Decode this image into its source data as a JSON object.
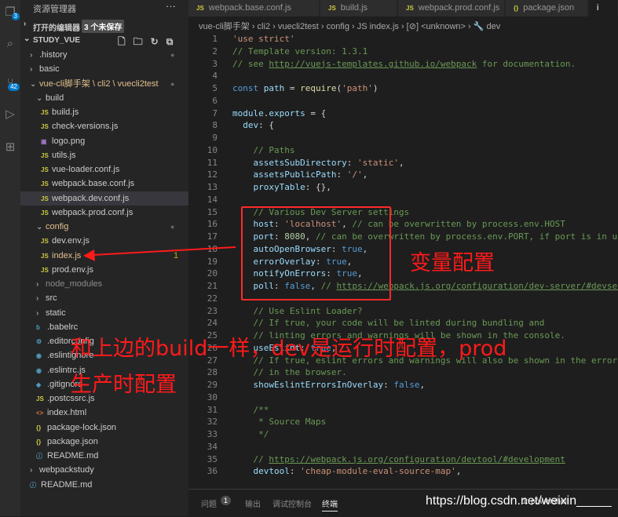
{
  "activity": {
    "explorer_badge": "3",
    "scm_badge": "42"
  },
  "sidebar": {
    "title": "资源管理器",
    "more": "···",
    "open_editors": {
      "label": "打开的编辑器",
      "badge": "3 个未保存"
    },
    "project": {
      "label": "STUDY_VUE"
    },
    "tree": [
      {
        "label": ".history",
        "kind": "folder",
        "chev": "›",
        "indent": 1,
        "dot": "●"
      },
      {
        "label": "basic",
        "kind": "folder",
        "chev": "›",
        "indent": 1
      },
      {
        "label": "vue-cli脚手架 \\ cli2 \\ vuecli2test",
        "kind": "folder",
        "chev": "⌄",
        "indent": 1,
        "git": true,
        "dot": "●"
      },
      {
        "label": "build",
        "kind": "folder",
        "chev": "⌄",
        "indent": 2
      },
      {
        "label": "build.js",
        "kind": "js",
        "icon": "JS",
        "indent": 3
      },
      {
        "label": "check-versions.js",
        "kind": "js",
        "icon": "JS",
        "indent": 3
      },
      {
        "label": "logo.png",
        "kind": "img",
        "icon": "▣",
        "indent": 3
      },
      {
        "label": "utils.js",
        "kind": "js",
        "icon": "JS",
        "indent": 3
      },
      {
        "label": "vue-loader.conf.js",
        "kind": "js",
        "icon": "JS",
        "indent": 3
      },
      {
        "label": "webpack.base.conf.js",
        "kind": "js",
        "icon": "JS",
        "indent": 3
      },
      {
        "label": "webpack.dev.conf.js",
        "kind": "js",
        "icon": "JS",
        "indent": 3,
        "selected": true
      },
      {
        "label": "webpack.prod.conf.js",
        "kind": "js",
        "icon": "JS",
        "indent": 3
      },
      {
        "label": "config",
        "kind": "folder",
        "chev": "⌄",
        "indent": 2,
        "git": true,
        "dot": "●"
      },
      {
        "label": "dev.env.js",
        "kind": "js",
        "icon": "JS",
        "indent": 3
      },
      {
        "label": "index.js",
        "kind": "js",
        "icon": "JS",
        "indent": 3,
        "git": true,
        "num": "1"
      },
      {
        "label": "prod.env.js",
        "kind": "js",
        "icon": "JS",
        "indent": 3
      },
      {
        "label": "node_modules",
        "kind": "folder",
        "chev": "›",
        "indent": 2,
        "muted": true
      },
      {
        "label": "src",
        "kind": "folder",
        "chev": "›",
        "indent": 2
      },
      {
        "label": "static",
        "kind": "folder",
        "chev": "›",
        "indent": 2
      },
      {
        "label": ".babelrc",
        "kind": "cfg",
        "icon": "ɓ",
        "indent": 2
      },
      {
        "label": ".editorconfig",
        "kind": "cfg",
        "icon": "⚙",
        "indent": 2
      },
      {
        "label": ".eslintignore",
        "kind": "cfg",
        "icon": "◉",
        "indent": 2
      },
      {
        "label": ".eslintrc.js",
        "kind": "cfg",
        "icon": "◉",
        "indent": 2
      },
      {
        "label": ".gitignore",
        "kind": "cfg",
        "icon": "◆",
        "indent": 2
      },
      {
        "label": ".postcssrc.js",
        "kind": "js",
        "icon": "JS",
        "indent": 2
      },
      {
        "label": "index.html",
        "kind": "html",
        "icon": "<>",
        "indent": 2
      },
      {
        "label": "package-lock.json",
        "kind": "json",
        "icon": "{}",
        "indent": 2
      },
      {
        "label": "package.json",
        "kind": "json",
        "icon": "{}",
        "indent": 2
      },
      {
        "label": "README.md",
        "kind": "md",
        "icon": "ⓘ",
        "indent": 2
      },
      {
        "label": "webpackstudy",
        "kind": "folder",
        "chev": "›",
        "indent": 1
      },
      {
        "label": "README.md",
        "kind": "md",
        "icon": "ⓘ",
        "indent": 1
      }
    ]
  },
  "tabs": [
    {
      "label": "webpack.base.conf.js",
      "icon": "JS"
    },
    {
      "label": "build.js",
      "icon": "JS"
    },
    {
      "label": "webpack.prod.conf.js",
      "icon": "JS"
    },
    {
      "label": "package.json",
      "icon": "{}"
    },
    {
      "label": "i",
      "icon": "",
      "active": true
    }
  ],
  "breadcrumb": "vue-cli脚手架  ›  cli2  ›  vuecli2test  ›  config  ›  JS  index.js  ›  [⊘] <unknown>  ›  🔧 dev",
  "code_lines": [
    [
      [
        "s",
        "'use strict'"
      ]
    ],
    [
      [
        "c",
        "// Template version: 1.3.1"
      ]
    ],
    [
      [
        "c",
        "// see "
      ],
      [
        "u",
        "http://vuejs-templates.github.io/webpack"
      ],
      [
        "c",
        " for documentation."
      ]
    ],
    [],
    [
      [
        "k",
        "const "
      ],
      [
        "v",
        "path"
      ],
      [
        "t",
        " = "
      ],
      [
        "f",
        "require"
      ],
      [
        "t",
        "("
      ],
      [
        "s",
        "'path'"
      ],
      [
        "t",
        ")"
      ]
    ],
    [],
    [
      [
        "v",
        "module"
      ],
      [
        "t",
        "."
      ],
      [
        "v",
        "exports"
      ],
      [
        "t",
        " = {"
      ]
    ],
    [
      [
        "t",
        "  "
      ],
      [
        "v",
        "dev"
      ],
      [
        "t",
        ": {"
      ]
    ],
    [],
    [
      [
        "t",
        "    "
      ],
      [
        "c",
        "// Paths"
      ]
    ],
    [
      [
        "t",
        "    "
      ],
      [
        "v",
        "assetsSubDirectory"
      ],
      [
        "t",
        ": "
      ],
      [
        "s",
        "'static'"
      ],
      [
        "t",
        ","
      ]
    ],
    [
      [
        "t",
        "    "
      ],
      [
        "v",
        "assetsPublicPath"
      ],
      [
        "t",
        ": "
      ],
      [
        "s",
        "'/'"
      ],
      [
        "t",
        ","
      ]
    ],
    [
      [
        "t",
        "    "
      ],
      [
        "v",
        "proxyTable"
      ],
      [
        "t",
        ": {},"
      ]
    ],
    [],
    [
      [
        "t",
        "    "
      ],
      [
        "c",
        "// Various Dev Server settings"
      ]
    ],
    [
      [
        "t",
        "    "
      ],
      [
        "v",
        "host"
      ],
      [
        "t",
        ": "
      ],
      [
        "s",
        "'localhost'"
      ],
      [
        "t",
        ", "
      ],
      [
        "c",
        "// can be overwritten by process.env.HOST"
      ]
    ],
    [
      [
        "t",
        "    "
      ],
      [
        "v",
        "port"
      ],
      [
        "t",
        ": "
      ],
      [
        "n",
        "8080"
      ],
      [
        "t",
        ", "
      ],
      [
        "c",
        "// can be overwritten by process.env.PORT, if port is in use, a free one will be determined"
      ]
    ],
    [
      [
        "t",
        "    "
      ],
      [
        "v",
        "autoOpenBrowser"
      ],
      [
        "t",
        ": "
      ],
      [
        "k",
        "true"
      ],
      [
        "t",
        ","
      ]
    ],
    [
      [
        "t",
        "    "
      ],
      [
        "v",
        "errorOverlay"
      ],
      [
        "t",
        ": "
      ],
      [
        "k",
        "true"
      ],
      [
        "t",
        ","
      ]
    ],
    [
      [
        "t",
        "    "
      ],
      [
        "v",
        "notifyOnErrors"
      ],
      [
        "t",
        ": "
      ],
      [
        "k",
        "true"
      ],
      [
        "t",
        ","
      ]
    ],
    [
      [
        "t",
        "    "
      ],
      [
        "v",
        "poll"
      ],
      [
        "t",
        ": "
      ],
      [
        "k",
        "false"
      ],
      [
        "t",
        ", "
      ],
      [
        "c",
        "// "
      ],
      [
        "u",
        "https://webpack.js.org/configuration/dev-server/#devserver-watchoptions-"
      ]
    ],
    [],
    [
      [
        "t",
        "    "
      ],
      [
        "c",
        "// Use Eslint Loader?"
      ]
    ],
    [
      [
        "t",
        "    "
      ],
      [
        "c",
        "// If true, your code will be linted during bundling and"
      ]
    ],
    [
      [
        "t",
        "    "
      ],
      [
        "c",
        "// linting errors and warnings will be shown in the console."
      ]
    ],
    [
      [
        "t",
        "    "
      ],
      [
        "v",
        "useEslint"
      ],
      [
        "t",
        ": "
      ],
      [
        "k",
        "true"
      ],
      [
        "t",
        ","
      ]
    ],
    [
      [
        "t",
        "    "
      ],
      [
        "c",
        "// If true, eslint errors and warnings will also be shown in the error overlay"
      ]
    ],
    [
      [
        "t",
        "    "
      ],
      [
        "c",
        "// in the browser."
      ]
    ],
    [
      [
        "t",
        "    "
      ],
      [
        "v",
        "showEslintErrorsInOverlay"
      ],
      [
        "t",
        ": "
      ],
      [
        "k",
        "false"
      ],
      [
        "t",
        ","
      ]
    ],
    [],
    [
      [
        "t",
        "    "
      ],
      [
        "c",
        "/**"
      ]
    ],
    [
      [
        "t",
        "     "
      ],
      [
        "c",
        "* Source Maps"
      ]
    ],
    [
      [
        "t",
        "     "
      ],
      [
        "c",
        "*/"
      ]
    ],
    [],
    [
      [
        "t",
        "    "
      ],
      [
        "c",
        "// "
      ],
      [
        "u",
        "https://webpack.js.org/configuration/devtool/#development"
      ]
    ],
    [
      [
        "t",
        "    "
      ],
      [
        "v",
        "devtool"
      ],
      [
        "t",
        ": "
      ],
      [
        "s",
        "'cheap-module-eval-source-map'"
      ],
      [
        "t",
        ","
      ]
    ]
  ],
  "panel": {
    "tabs": [
      "问题",
      "输出",
      "调试控制台",
      "终端"
    ],
    "problems_count": "1",
    "terminal_name": "1: powershell",
    "watermark": "https://blog.csdn.net/weixin_____"
  },
  "annotations": {
    "box_label": "变量配置",
    "note_line1": "和上边的build一样，dev是运行时配置，prod",
    "note_line2": "生产时配置"
  },
  "colors": {
    "annotation_red": "#ff1a1a",
    "accent": "#007acc"
  }
}
